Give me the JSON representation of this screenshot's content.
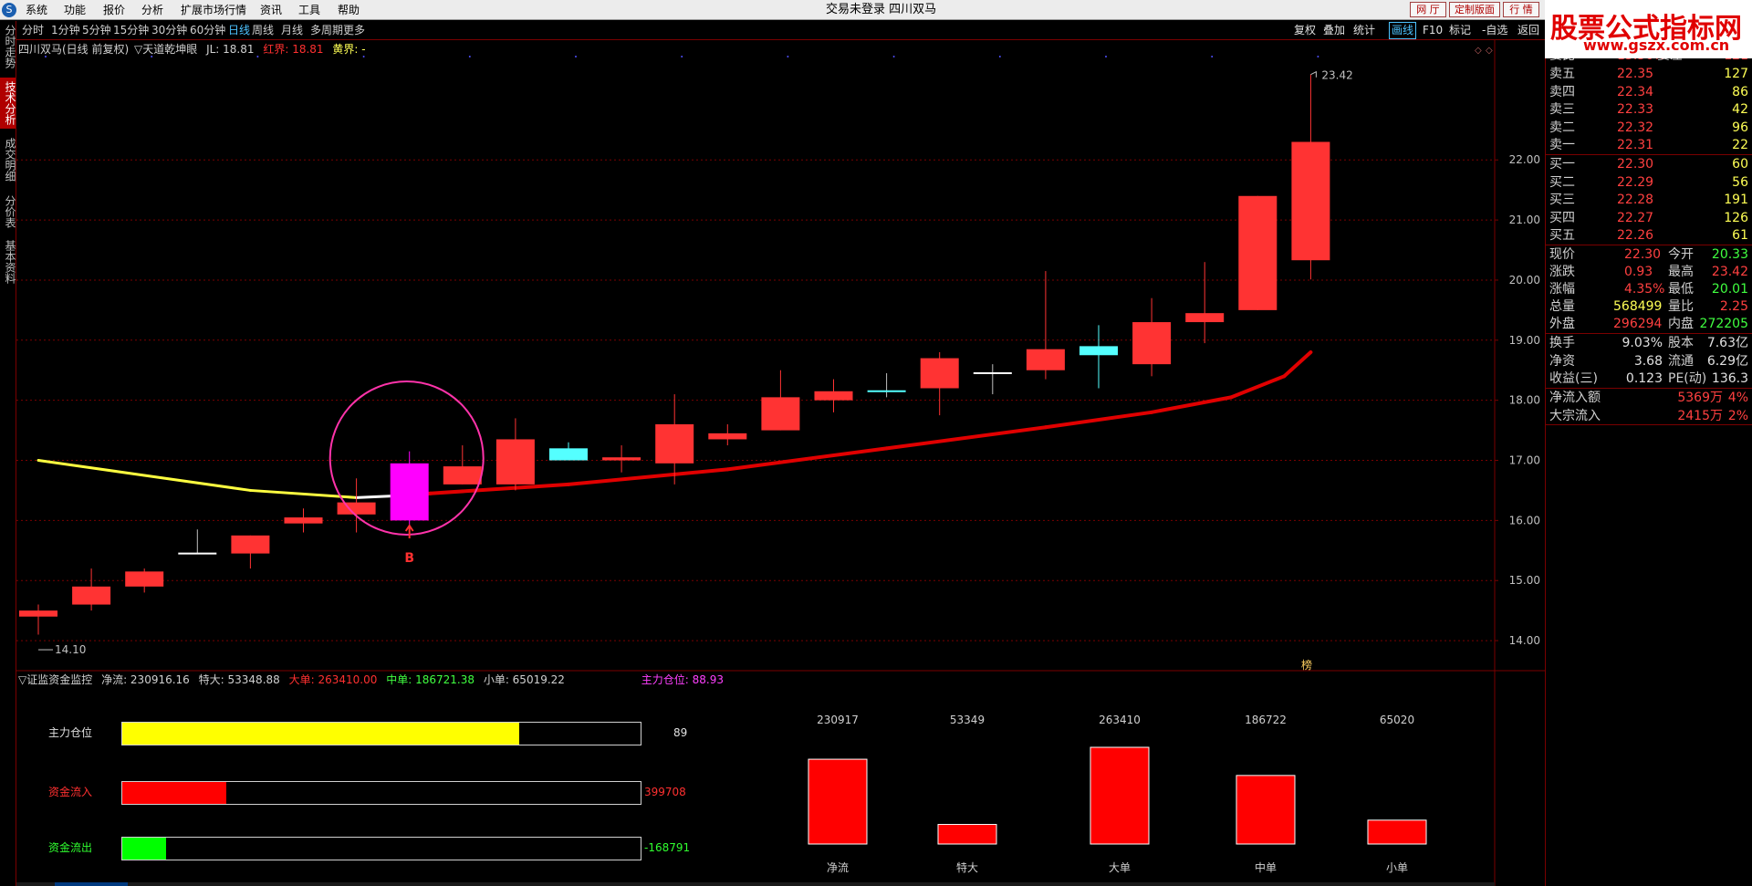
{
  "menubar": {
    "logo": "S",
    "items": [
      "系统",
      "功能",
      "报价",
      "分析",
      "扩展市场行情",
      "资讯",
      "工具",
      "帮助"
    ],
    "window_title": "交易未登录  四川双马",
    "top_buttons": [
      "网 厅",
      "定制版面",
      "行 情"
    ]
  },
  "brand": {
    "title": "股票公式指标网",
    "url": "www.gszx.com.cn"
  },
  "periods": {
    "items": [
      "分时",
      "1分钟",
      "5分钟",
      "15分钟",
      "30分钟",
      "60分钟",
      "日线",
      "周线",
      "月线",
      "多周期",
      "更多"
    ],
    "active": "日线"
  },
  "toolbar_right": {
    "items": [
      "复权",
      "叠加",
      "统计",
      "画线",
      "F10",
      "标记",
      "-自选",
      "返回"
    ],
    "active": "画线"
  },
  "left_tabs": [
    {
      "label": "分时走势",
      "active": false
    },
    {
      "label": "技术分析",
      "active": true
    },
    {
      "label": "成交明细",
      "active": false
    },
    {
      "label": "分价表",
      "active": false
    },
    {
      "label": "基本资料",
      "active": false
    }
  ],
  "chart_info": {
    "stock": "四川双马(日线 前复权)",
    "indicator": "▽天道乾坤眼",
    "jl": "JL: 18.81",
    "red": "红界: 18.81",
    "yellow": "黄界: -"
  },
  "ind2_info": {
    "name": "▽证监资金监控",
    "jingliu": "净流: 230916.16",
    "teda": "特大: 53348.88",
    "dadan_label": "大单:",
    "dadan": "263410.00",
    "zhongdan": "中单: 186721.38",
    "xiaodan": "小单: 65019.22",
    "zhuli": "主力仓位: 88.93"
  },
  "colors": {
    "up": "#ff3333",
    "down_cyan": "#54ffff",
    "signal": "#ff00ff",
    "ma_red": "#e00000",
    "ma_yellow": "#ffff40",
    "grid": "#7a0000",
    "axis_text": "#c0c0c0"
  },
  "chart_data": {
    "type": "candlestick",
    "ylim": [
      13.5,
      23.75
    ],
    "yticks": [
      "14.00",
      "15.00",
      "16.00",
      "17.00",
      "18.00",
      "19.00",
      "20.00",
      "21.00",
      "22.00"
    ],
    "candles": [
      {
        "o": 14.4,
        "h": 14.6,
        "l": 14.1,
        "c": 14.5,
        "color": "up"
      },
      {
        "o": 14.6,
        "h": 15.2,
        "l": 14.5,
        "c": 14.9,
        "color": "up"
      },
      {
        "o": 14.9,
        "h": 15.2,
        "l": 14.8,
        "c": 15.15,
        "color": "up"
      },
      {
        "o": 15.45,
        "h": 15.85,
        "l": 15.45,
        "c": 15.45,
        "color": "cross"
      },
      {
        "o": 15.45,
        "h": 15.75,
        "l": 15.2,
        "c": 15.75,
        "color": "up"
      },
      {
        "o": 15.95,
        "h": 16.2,
        "l": 15.8,
        "c": 16.05,
        "color": "up"
      },
      {
        "o": 16.1,
        "h": 16.7,
        "l": 15.8,
        "c": 16.3,
        "color": "up"
      },
      {
        "o": 16.0,
        "h": 17.15,
        "l": 15.85,
        "c": 16.95,
        "color": "signal"
      },
      {
        "o": 16.6,
        "h": 17.25,
        "l": 16.6,
        "c": 16.9,
        "color": "up"
      },
      {
        "o": 16.6,
        "h": 17.7,
        "l": 16.5,
        "c": 17.35,
        "color": "up"
      },
      {
        "o": 17.2,
        "h": 17.3,
        "l": 17.0,
        "c": 17.0,
        "color": "down"
      },
      {
        "o": 17.0,
        "h": 17.25,
        "l": 16.8,
        "c": 17.05,
        "color": "up"
      },
      {
        "o": 16.95,
        "h": 18.1,
        "l": 16.6,
        "c": 17.6,
        "color": "up"
      },
      {
        "o": 17.35,
        "h": 17.6,
        "l": 17.25,
        "c": 17.45,
        "color": "up"
      },
      {
        "o": 17.5,
        "h": 18.5,
        "l": 17.5,
        "c": 18.05,
        "color": "up"
      },
      {
        "o": 18.0,
        "h": 18.35,
        "l": 17.8,
        "c": 18.15,
        "color": "up"
      },
      {
        "o": 18.15,
        "h": 18.45,
        "l": 18.05,
        "c": 18.15,
        "color": "cross"
      },
      {
        "o": 18.2,
        "h": 18.8,
        "l": 17.75,
        "c": 18.7,
        "color": "up"
      },
      {
        "o": 18.45,
        "h": 18.6,
        "l": 18.1,
        "c": 18.45,
        "color": "cross"
      },
      {
        "o": 18.5,
        "h": 20.15,
        "l": 18.35,
        "c": 18.85,
        "color": "up"
      },
      {
        "o": 18.9,
        "h": 19.25,
        "l": 18.2,
        "c": 18.75,
        "color": "down"
      },
      {
        "o": 18.6,
        "h": 19.7,
        "l": 18.4,
        "c": 19.3,
        "color": "up"
      },
      {
        "o": 19.3,
        "h": 20.3,
        "l": 18.95,
        "c": 19.45,
        "color": "up"
      },
      {
        "o": 19.5,
        "h": 21.4,
        "l": 19.5,
        "c": 21.4,
        "color": "up"
      },
      {
        "o": 20.33,
        "h": 23.42,
        "l": 20.01,
        "c": 22.3,
        "color": "up"
      }
    ],
    "ma_line": [
      {
        "i": 0,
        "v": 17.0,
        "c": "yellow"
      },
      {
        "i": 2,
        "v": 16.75,
        "c": "yellow"
      },
      {
        "i": 4,
        "v": 16.5,
        "c": "yellow"
      },
      {
        "i": 6,
        "v": 16.38,
        "c": "yellow"
      },
      {
        "i": 7,
        "v": 16.42,
        "c": "white"
      },
      {
        "i": 7.4,
        "v": 16.45,
        "c": "red"
      },
      {
        "i": 10,
        "v": 16.6,
        "c": "red"
      },
      {
        "i": 13,
        "v": 16.85,
        "c": "red"
      },
      {
        "i": 16,
        "v": 17.2,
        "c": "red"
      },
      {
        "i": 19,
        "v": 17.55,
        "c": "red"
      },
      {
        "i": 21,
        "v": 17.8,
        "c": "red"
      },
      {
        "i": 22.5,
        "v": 18.05,
        "c": "red"
      },
      {
        "i": 23.5,
        "v": 18.4,
        "c": "red"
      },
      {
        "i": 24,
        "v": 18.8,
        "c": "red"
      }
    ],
    "high_label": "23.42",
    "low_label": "14.10",
    "signal_label": "B",
    "mark_label": "榜"
  },
  "fund_bars": [
    {
      "label": "主力仓位",
      "value": "89",
      "fraction": 0.765,
      "color": "#ffff00",
      "label_color": "#e0e0e0",
      "value_color": "#e0e0e0"
    },
    {
      "label": "资金流入",
      "value": "399708",
      "fraction": 0.2,
      "color": "#ff0000",
      "label_color": "#ff3030",
      "value_color": "#ff3030"
    },
    {
      "label": "资金流出",
      "value": "-168791",
      "fraction": 0.085,
      "color": "#00ff00",
      "label_color": "#30ff30",
      "value_color": "#30ff30"
    }
  ],
  "flow_bars": {
    "max": 263410,
    "items": [
      {
        "name": "净流",
        "value": 230917
      },
      {
        "name": "特大",
        "value": 53349
      },
      {
        "name": "大单",
        "value": 263410
      },
      {
        "name": "中单",
        "value": 186722
      },
      {
        "name": "小单",
        "value": 65020
      }
    ]
  },
  "order_book": {
    "top_partial": [
      "委比",
      "13.56%",
      "委差",
      "121"
    ],
    "asks": [
      {
        "label": "卖五",
        "price": "22.35",
        "vol": "127"
      },
      {
        "label": "卖四",
        "price": "22.34",
        "vol": "86"
      },
      {
        "label": "卖三",
        "price": "22.33",
        "vol": "42"
      },
      {
        "label": "卖二",
        "price": "22.32",
        "vol": "96"
      },
      {
        "label": "卖一",
        "price": "22.31",
        "vol": "22"
      }
    ],
    "bids": [
      {
        "label": "买一",
        "price": "22.30",
        "vol": "60"
      },
      {
        "label": "买二",
        "price": "22.29",
        "vol": "56"
      },
      {
        "label": "买三",
        "price": "22.28",
        "vol": "191"
      },
      {
        "label": "买四",
        "price": "22.27",
        "vol": "126"
      },
      {
        "label": "买五",
        "price": "22.26",
        "vol": "61"
      }
    ]
  },
  "quote": [
    {
      "l1": "现价",
      "v1": "22.30",
      "c1": "#ff4040",
      "l2": "今开",
      "v2": "20.33",
      "c2": "#40ff40"
    },
    {
      "l1": "涨跌",
      "v1": "0.93",
      "c1": "#ff4040",
      "l2": "最高",
      "v2": "23.42",
      "c2": "#ff4040"
    },
    {
      "l1": "涨幅",
      "v1": "4.35%",
      "c1": "#ff4040",
      "l2": "最低",
      "v2": "20.01",
      "c2": "#40ff40"
    },
    {
      "l1": "总量",
      "v1": "568499",
      "c1": "#ffff55",
      "l2": "量比",
      "v2": "2.25",
      "c2": "#ff4040"
    },
    {
      "l1": "外盘",
      "v1": "296294",
      "c1": "#ff4040",
      "l2": "内盘",
      "v2": "272205",
      "c2": "#40ff40"
    }
  ],
  "stats": [
    {
      "l1": "换手",
      "v1": "9.03%",
      "l2": "股本",
      "v2": "7.63亿"
    },
    {
      "l1": "净资",
      "v1": "3.68",
      "l2": "流通",
      "v2": "6.29亿"
    },
    {
      "l1": "收益(三)",
      "v1": "0.123",
      "l2": "PE(动)",
      "v2": "136.3"
    }
  ],
  "flows": [
    {
      "label": "净流入额",
      "value": "5369万",
      "pct": "4%"
    },
    {
      "label": "大宗流入",
      "value": "2415万",
      "pct": "2%"
    }
  ]
}
